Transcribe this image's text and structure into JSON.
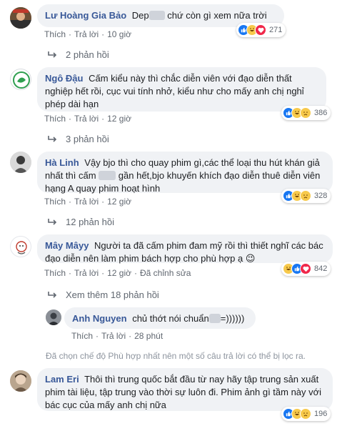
{
  "comments": [
    {
      "author": "Lư Hoàng Gia Bảo",
      "text_before": "Dep",
      "text_after": " chứ còn gì xem nữa trời",
      "actions": {
        "like": "Thích",
        "reply": "Trả lời",
        "time": "10 giờ"
      },
      "reaction_count": "271",
      "replies": "2 phản hồi"
    },
    {
      "author": "Ngô Đậu",
      "text": "Cấm kiểu này thì chắc diễn viên với đạo diễn thất nghiệp hết rồi, cục vui tính nhở, kiểu như cho mấy anh chị nghỉ phép dài hạn",
      "actions": {
        "like": "Thích",
        "reply": "Trả lời",
        "time": "12 giờ"
      },
      "reaction_count": "386",
      "replies": "3 phản hồi"
    },
    {
      "author": "Hà Linh",
      "text_before": "Vậy bjo thì cho quay phim gì,các thể loại thu hút khán giả nhất thì cấm",
      "text_after": " gần hết,bjo khuyến khích đạo diễn thuê diễn viên hạng A quay phim hoạt hình",
      "actions": {
        "like": "Thích",
        "reply": "Trả lời",
        "time": "12 giờ"
      },
      "reaction_count": "328",
      "replies": "12 phản hồi"
    },
    {
      "author": "Mây Mâyy",
      "text": "Người ta đã cấm phim đam mỹ rồi thì thiết nghĩ các bác đạo diễn nên làm phim bách hợp cho phù hợp ạ",
      "emoji": "😉",
      "actions": {
        "like": "Thích",
        "reply": "Trả lời",
        "time": "12 giờ",
        "edited": "Đã chỉnh sửa"
      },
      "reaction_count": "842",
      "replies": "Xem thêm 18 phản hồi"
    }
  ],
  "reply": {
    "author": "Anh Nguyen",
    "text_before": "chủ thớt nói chuẩn",
    "text_after": "=))))))",
    "actions": {
      "like": "Thích",
      "reply": "Trả lời",
      "time": "28 phút"
    }
  },
  "notice": "Đã chọn chế độ Phù hợp nhất nên một số câu trả lời có thể bị lọc ra.",
  "last_comment": {
    "author": "Lam Eri",
    "text": "Thôi thì trung quốc bắt đầu từ nay hãy tập trung sản xuất phim tài liệu, tập trung vào thời sự luôn đi. Phim ảnh gì tầm này với bác cục của mấy anh chị nữa",
    "reaction_count": "196"
  },
  "colors": {
    "link": "#385898",
    "bubble": "#f0f2f5",
    "meta": "#606770",
    "like": "#1877f2",
    "love": "#f0284a",
    "haha": "#f7c94b"
  }
}
